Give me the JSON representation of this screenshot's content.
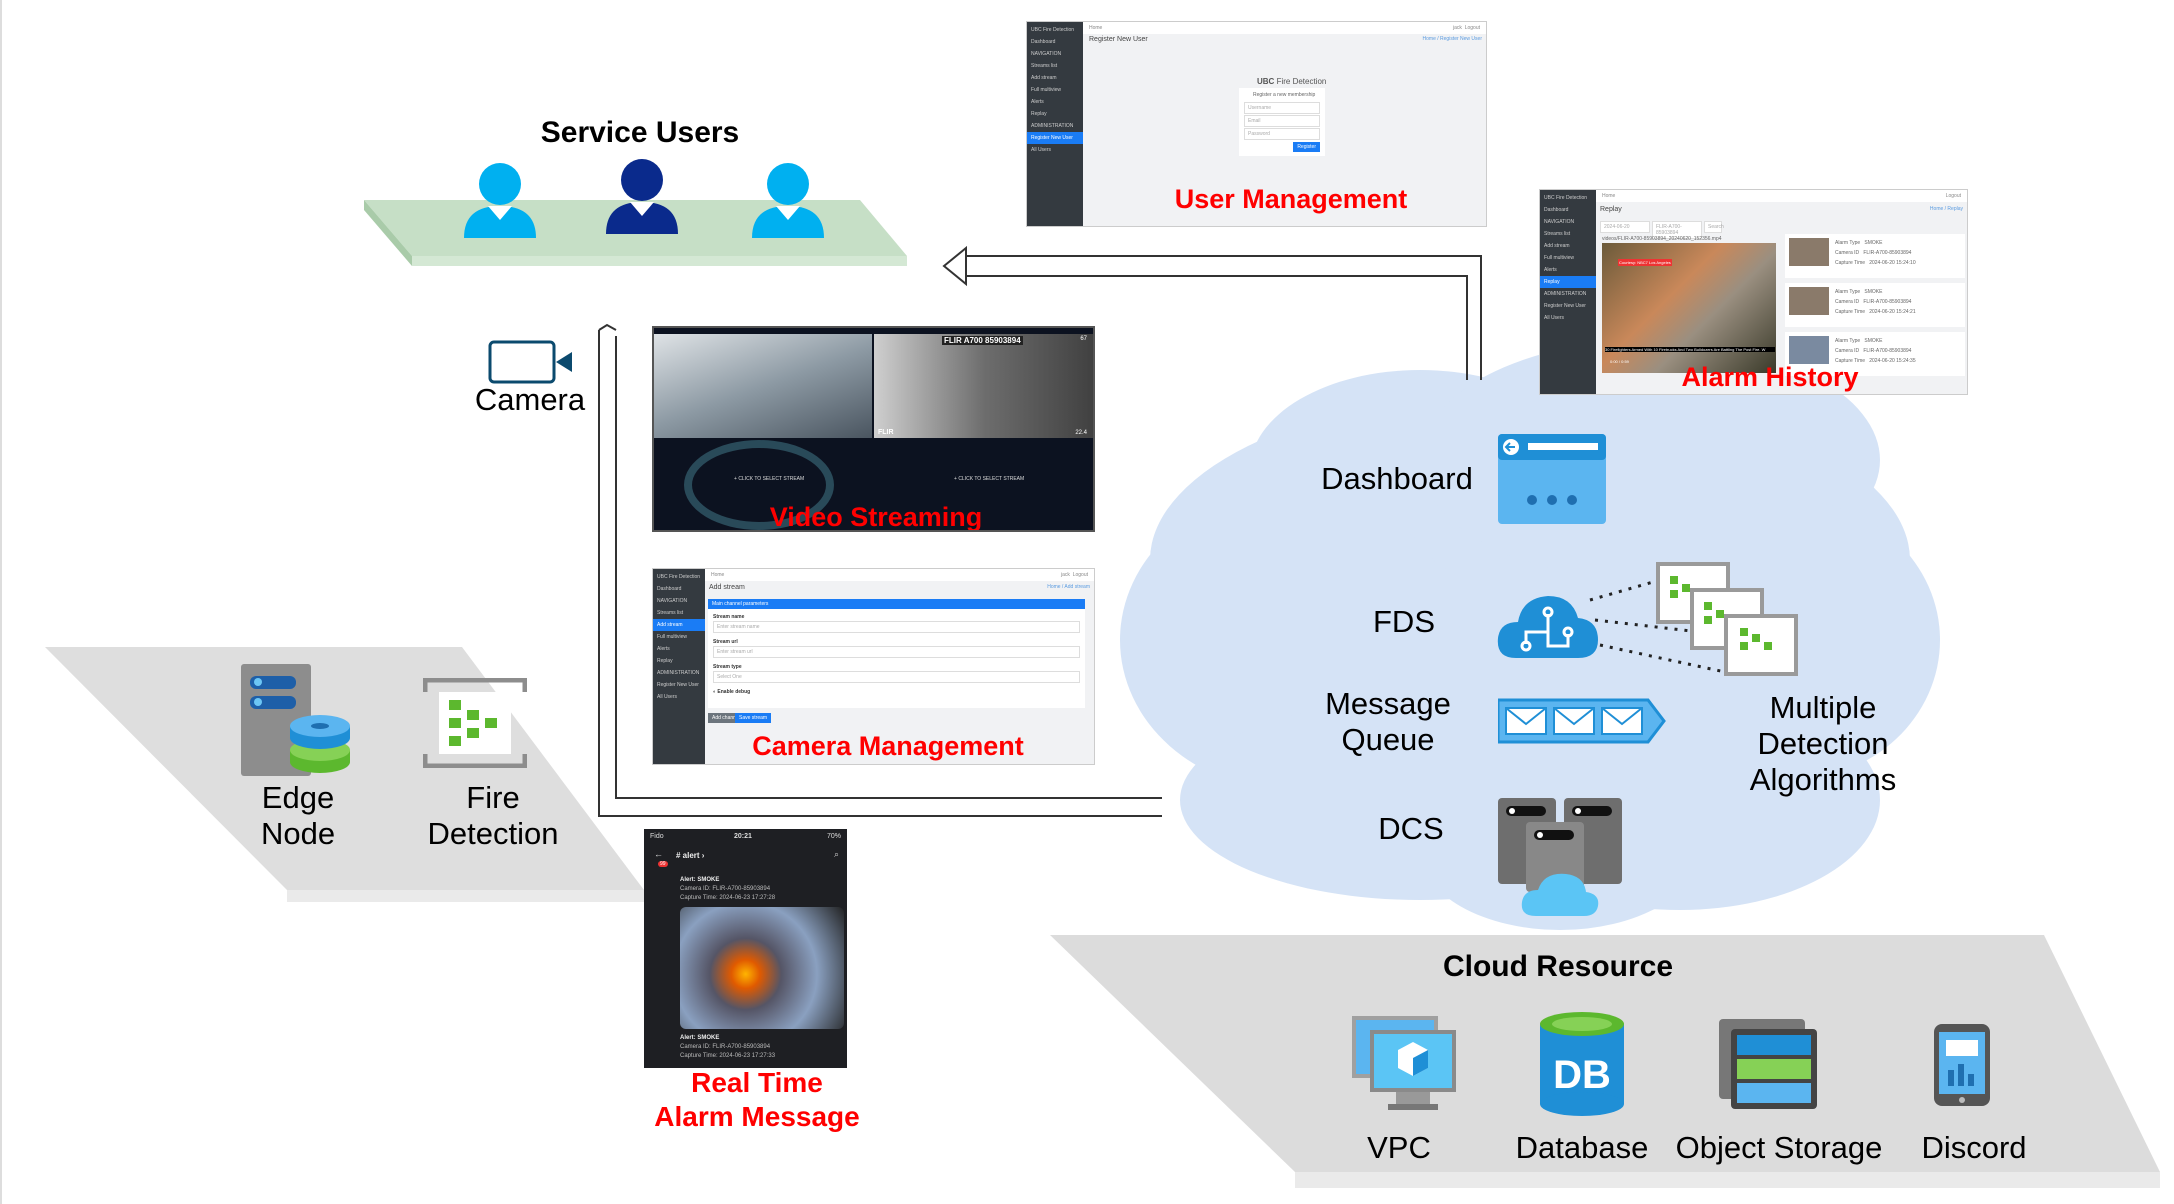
{
  "service_users": {
    "title": "Service Users",
    "icon": "user-icon",
    "colors": [
      "#00b0f0",
      "#0a2a8c",
      "#00b0f0"
    ]
  },
  "camera": {
    "label": "Camera",
    "icon": "video-camera-icon"
  },
  "edge": {
    "edge_node_label": [
      "Edge",
      "Node"
    ],
    "fire_detection_label": [
      "Fire",
      "Detection"
    ]
  },
  "screens": {
    "user_management": {
      "caption": "User Management",
      "app_name": "UBC Fire Detection",
      "nav_home": "Home",
      "user": "jack",
      "logout": "Logout",
      "page_title": "Register New User",
      "breadcrumb": "Home / Register New User",
      "sidebar": [
        "Dashboard",
        "NAVIGATION",
        "Streams list",
        "Add stream",
        "Full multiview",
        "Alerts",
        "Replay",
        "ADMINISTRATION",
        "Register New User",
        "All Users"
      ],
      "brand_bold": "UBC",
      "brand_light": "Fire Detection",
      "form_title": "Register a new membership",
      "fields": [
        "Username",
        "Email",
        "Password"
      ],
      "submit": "Register"
    },
    "alarm_history": {
      "caption": "Alarm History",
      "app_name": "UBC Fire Detection",
      "nav_home": "Home",
      "logout": "Logout",
      "page_title": "Replay",
      "breadcrumb": "Home / Replay",
      "sidebar": [
        "Dashboard",
        "NAVIGATION",
        "Streams list",
        "Add stream",
        "Full multiview",
        "Alerts",
        "Replay",
        "ADMINISTRATION",
        "Register New User",
        "All Users"
      ],
      "date": "2024-06-20",
      "camera_select": "FLIR-A700-85903894",
      "search": "Search",
      "video_file": "videos/FLIR-A700-85903894_20240620_152356.mp4",
      "news_ticker": "30 Firefighters Armed With 10 Firetrucks And Two Bulldozers Are Battling The Post Fire. W",
      "news_tag": "Courtesy: NBC7 Los Angeles",
      "video_time": "0:00 / 0:59",
      "record_labels": [
        "Alarm Type",
        "Camera ID",
        "Capture Time"
      ],
      "records": [
        {
          "type": "SMOKE",
          "camera": "FLIR-A700-85903894",
          "time": "2024-06-20 15:24:10"
        },
        {
          "type": "SMOKE",
          "camera": "FLIR-A700-85903894",
          "time": "2024-06-20 15:24:21"
        },
        {
          "type": "SMOKE",
          "camera": "FLIR-A700-85903894",
          "time": "2024-06-20 15:24:35"
        }
      ]
    },
    "video_streaming": {
      "caption": "Video Streaming",
      "camera_title": "FLIR A700 85903894",
      "temp_top": "67",
      "temp_bottom": "22.4",
      "brand": "FLIR",
      "select_stream": "CLICK TO SELECT STREAM"
    },
    "camera_management": {
      "caption": "Camera Management",
      "app_name": "UBC Fire Detection",
      "nav_home": "Home",
      "user": "jack",
      "logout": "Logout",
      "page_title": "Add stream",
      "breadcrumb": "Home / Add stream",
      "sidebar": [
        "Dashboard",
        "NAVIGATION",
        "Streams list",
        "Add stream",
        "Full multiview",
        "Alerts",
        "Replay",
        "ADMINISTRATION",
        "Register New User",
        "All Users"
      ],
      "panel_title": "Main channel parameters",
      "stream_name_label": "Stream name",
      "stream_name_placeholder": "Enter stream name",
      "stream_url_label": "Stream url",
      "stream_url_placeholder": "Enter stream url",
      "stream_type_label": "Stream type",
      "stream_type_value": "Select One",
      "debug_label": "Enable debug",
      "add_channel": "Add channel",
      "save_stream": "Save stream"
    },
    "alarm_message": {
      "caption": [
        "Real Time",
        "Alarm Message"
      ],
      "carrier": "Fido",
      "clock": "20:21",
      "battery": "70%",
      "channel": "alert",
      "badge": "99",
      "messages": [
        {
          "title": "Alert: SMOKE",
          "camera": "Camera ID: FLIR-A700-85903894",
          "time": "Capture Time: 2024-06-23 17:27:28"
        },
        {
          "title": "Alert: SMOKE",
          "camera": "Camera ID: FLIR-A700-85903894",
          "time": "Capture Time: 2024-06-23 17:27:33"
        }
      ]
    }
  },
  "cloud": {
    "dashboard": "Dashboard",
    "fds": "FDS",
    "message_queue": [
      "Message",
      "Queue"
    ],
    "dcs": "DCS",
    "algorithms": [
      "Multiple",
      "Detection",
      "Algorithms"
    ],
    "color": "#d5e3f6"
  },
  "cloud_resource": {
    "title": "Cloud Resource",
    "items": [
      {
        "label": "VPC",
        "icon": "vpc-icon"
      },
      {
        "label": "Database",
        "icon": "database-icon",
        "icon_text": "DB"
      },
      {
        "label": "Object Storage",
        "icon": "object-storage-icon"
      },
      {
        "label": "Discord",
        "icon": "mobile-phone-icon"
      }
    ]
  },
  "colors": {
    "caption_red": "#ff0000",
    "azure_blue": "#1f8fd6",
    "green": "#5cb82e"
  }
}
